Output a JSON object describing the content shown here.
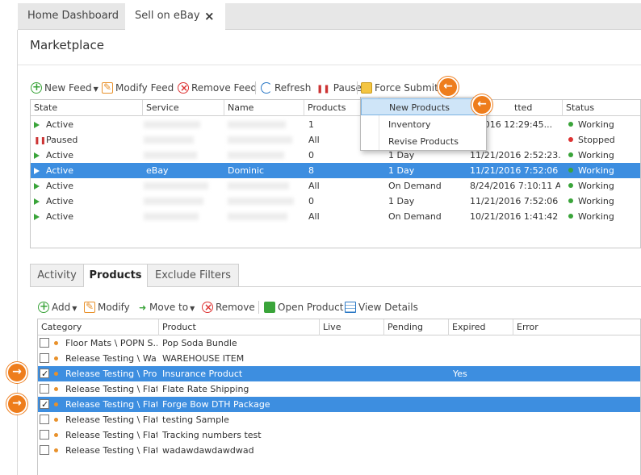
{
  "doc_tabs": [
    {
      "label": "Home Dashboard"
    },
    {
      "label": "Sell on eBay",
      "close": "×"
    }
  ],
  "page_title": "Marketplace",
  "feed_toolbar": {
    "new_feed": "New Feed",
    "modify_feed": "Modify Feed",
    "remove_feed": "Remove Feed",
    "refresh": "Refresh",
    "pause": "Pause",
    "force_submit": "Force Submit"
  },
  "feed_grid": {
    "headers": {
      "state": "State",
      "service": "Service",
      "name": "Name",
      "products": "Products",
      "submitted": "tted",
      "status": "Status"
    },
    "rows": [
      {
        "state": "Active",
        "service": "",
        "name": "",
        "products": "1",
        "freq": "",
        "submitted": "1/2016 12:29:45...",
        "status": "Working"
      },
      {
        "state": "Paused",
        "service": "",
        "name": "",
        "products": "All",
        "freq": "",
        "submitted": "",
        "status": "Stopped"
      },
      {
        "state": "Active",
        "service": "",
        "name": "",
        "products": "0",
        "freq": "1 Day",
        "submitted": "11/21/2016 2:52:23...",
        "status": "Working"
      },
      {
        "state": "Active",
        "service": "eBay",
        "name": "Dominic",
        "products": "8",
        "freq": "1 Day",
        "submitted": "11/21/2016 7:52:06 P...",
        "status": "Working"
      },
      {
        "state": "Active",
        "service": "",
        "name": "",
        "products": "All",
        "freq": "On Demand",
        "submitted": "8/24/2016 7:10:11 AM",
        "status": "Working"
      },
      {
        "state": "Active",
        "service": "",
        "name": "",
        "products": "0",
        "freq": "1 Day",
        "submitted": "11/21/2016 7:52:06 P...",
        "status": "Working"
      },
      {
        "state": "Active",
        "service": "",
        "name": "",
        "products": "All",
        "freq": "On Demand",
        "submitted": "10/21/2016 1:41:42 P...",
        "status": "Working"
      }
    ]
  },
  "force_submit_menu": [
    {
      "label": "New Products"
    },
    {
      "label": "Inventory"
    },
    {
      "label": "Revise Products"
    }
  ],
  "bottom_tabs": [
    {
      "label": "Activity"
    },
    {
      "label": "Products"
    },
    {
      "label": "Exclude Filters"
    }
  ],
  "products_toolbar": {
    "add": "Add",
    "modify": "Modify",
    "move_to": "Move to",
    "remove": "Remove",
    "open_product": "Open Product",
    "view_details": "View Details"
  },
  "products_grid": {
    "headers": {
      "category": "Category",
      "product": "Product",
      "live": "Live",
      "pending": "Pending",
      "expired": "Expired",
      "error": "Error"
    },
    "rows": [
      {
        "checked": false,
        "category": "Floor Mats \\ POPN S...",
        "product": "Pop Soda Bundle",
        "expired": ""
      },
      {
        "checked": false,
        "category": "Release Testing \\ Wa...",
        "product": "WAREHOUSE ITEM",
        "expired": ""
      },
      {
        "checked": true,
        "category": "Release Testing \\ Pro...",
        "product": "Insurance Product",
        "expired": "Yes"
      },
      {
        "checked": false,
        "category": "Release Testing \\ Flat...",
        "product": "Flate Rate Shipping",
        "expired": ""
      },
      {
        "checked": true,
        "category": "Release Testing \\ Flat...",
        "product": "Forge Bow DTH Package",
        "expired": ""
      },
      {
        "checked": false,
        "category": "Release Testing \\ Flat...",
        "product": "testing Sample",
        "expired": ""
      },
      {
        "checked": false,
        "category": "Release Testing \\ Flat...",
        "product": "Tracking numbers test",
        "expired": ""
      },
      {
        "checked": false,
        "category": "Release Testing \\ Flat...",
        "product": "wadawdawdawdwad",
        "expired": ""
      }
    ]
  },
  "callout_arrows": {
    "left": "←",
    "right": "→"
  },
  "colors": {
    "selection": "#3d8ee0",
    "accent_orange": "#ee7d1c",
    "active_green": "#3aa43a",
    "stopped_red": "#d33333"
  }
}
